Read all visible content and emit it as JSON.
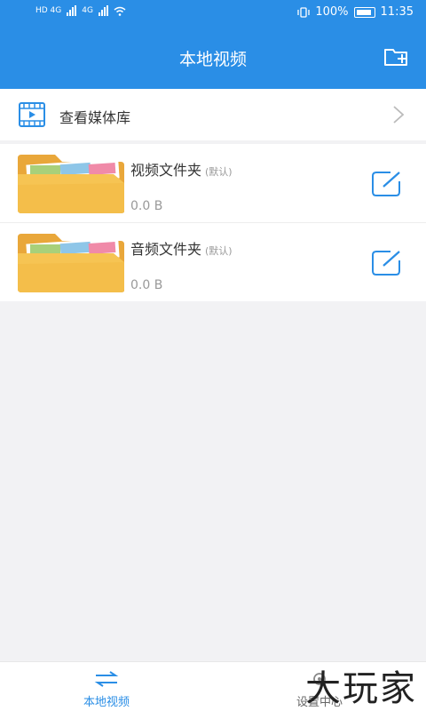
{
  "status_bar": {
    "network_left": "HD 4G",
    "network_right": "4G",
    "battery": "100%",
    "time": "11:35"
  },
  "header": {
    "title": "本地视频",
    "new_folder_icon": "folder-plus-icon"
  },
  "media_library": {
    "label": "查看媒体库",
    "icon": "film-icon"
  },
  "folders": [
    {
      "name": "视频文件夹",
      "tag": "(默认)",
      "size": "0.0 B"
    },
    {
      "name": "音频文件夹",
      "tag": "(默认)",
      "size": "0.0 B"
    }
  ],
  "tabs": [
    {
      "label": "本地视频",
      "icon": "swap-arrows-icon",
      "active": true
    },
    {
      "label": "设置中心",
      "icon": "settings-icon",
      "active": false
    }
  ],
  "watermark": "大玩家",
  "colors": {
    "primary": "#2a8ee6",
    "folder": "#f6c453",
    "background": "#f2f2f4"
  }
}
